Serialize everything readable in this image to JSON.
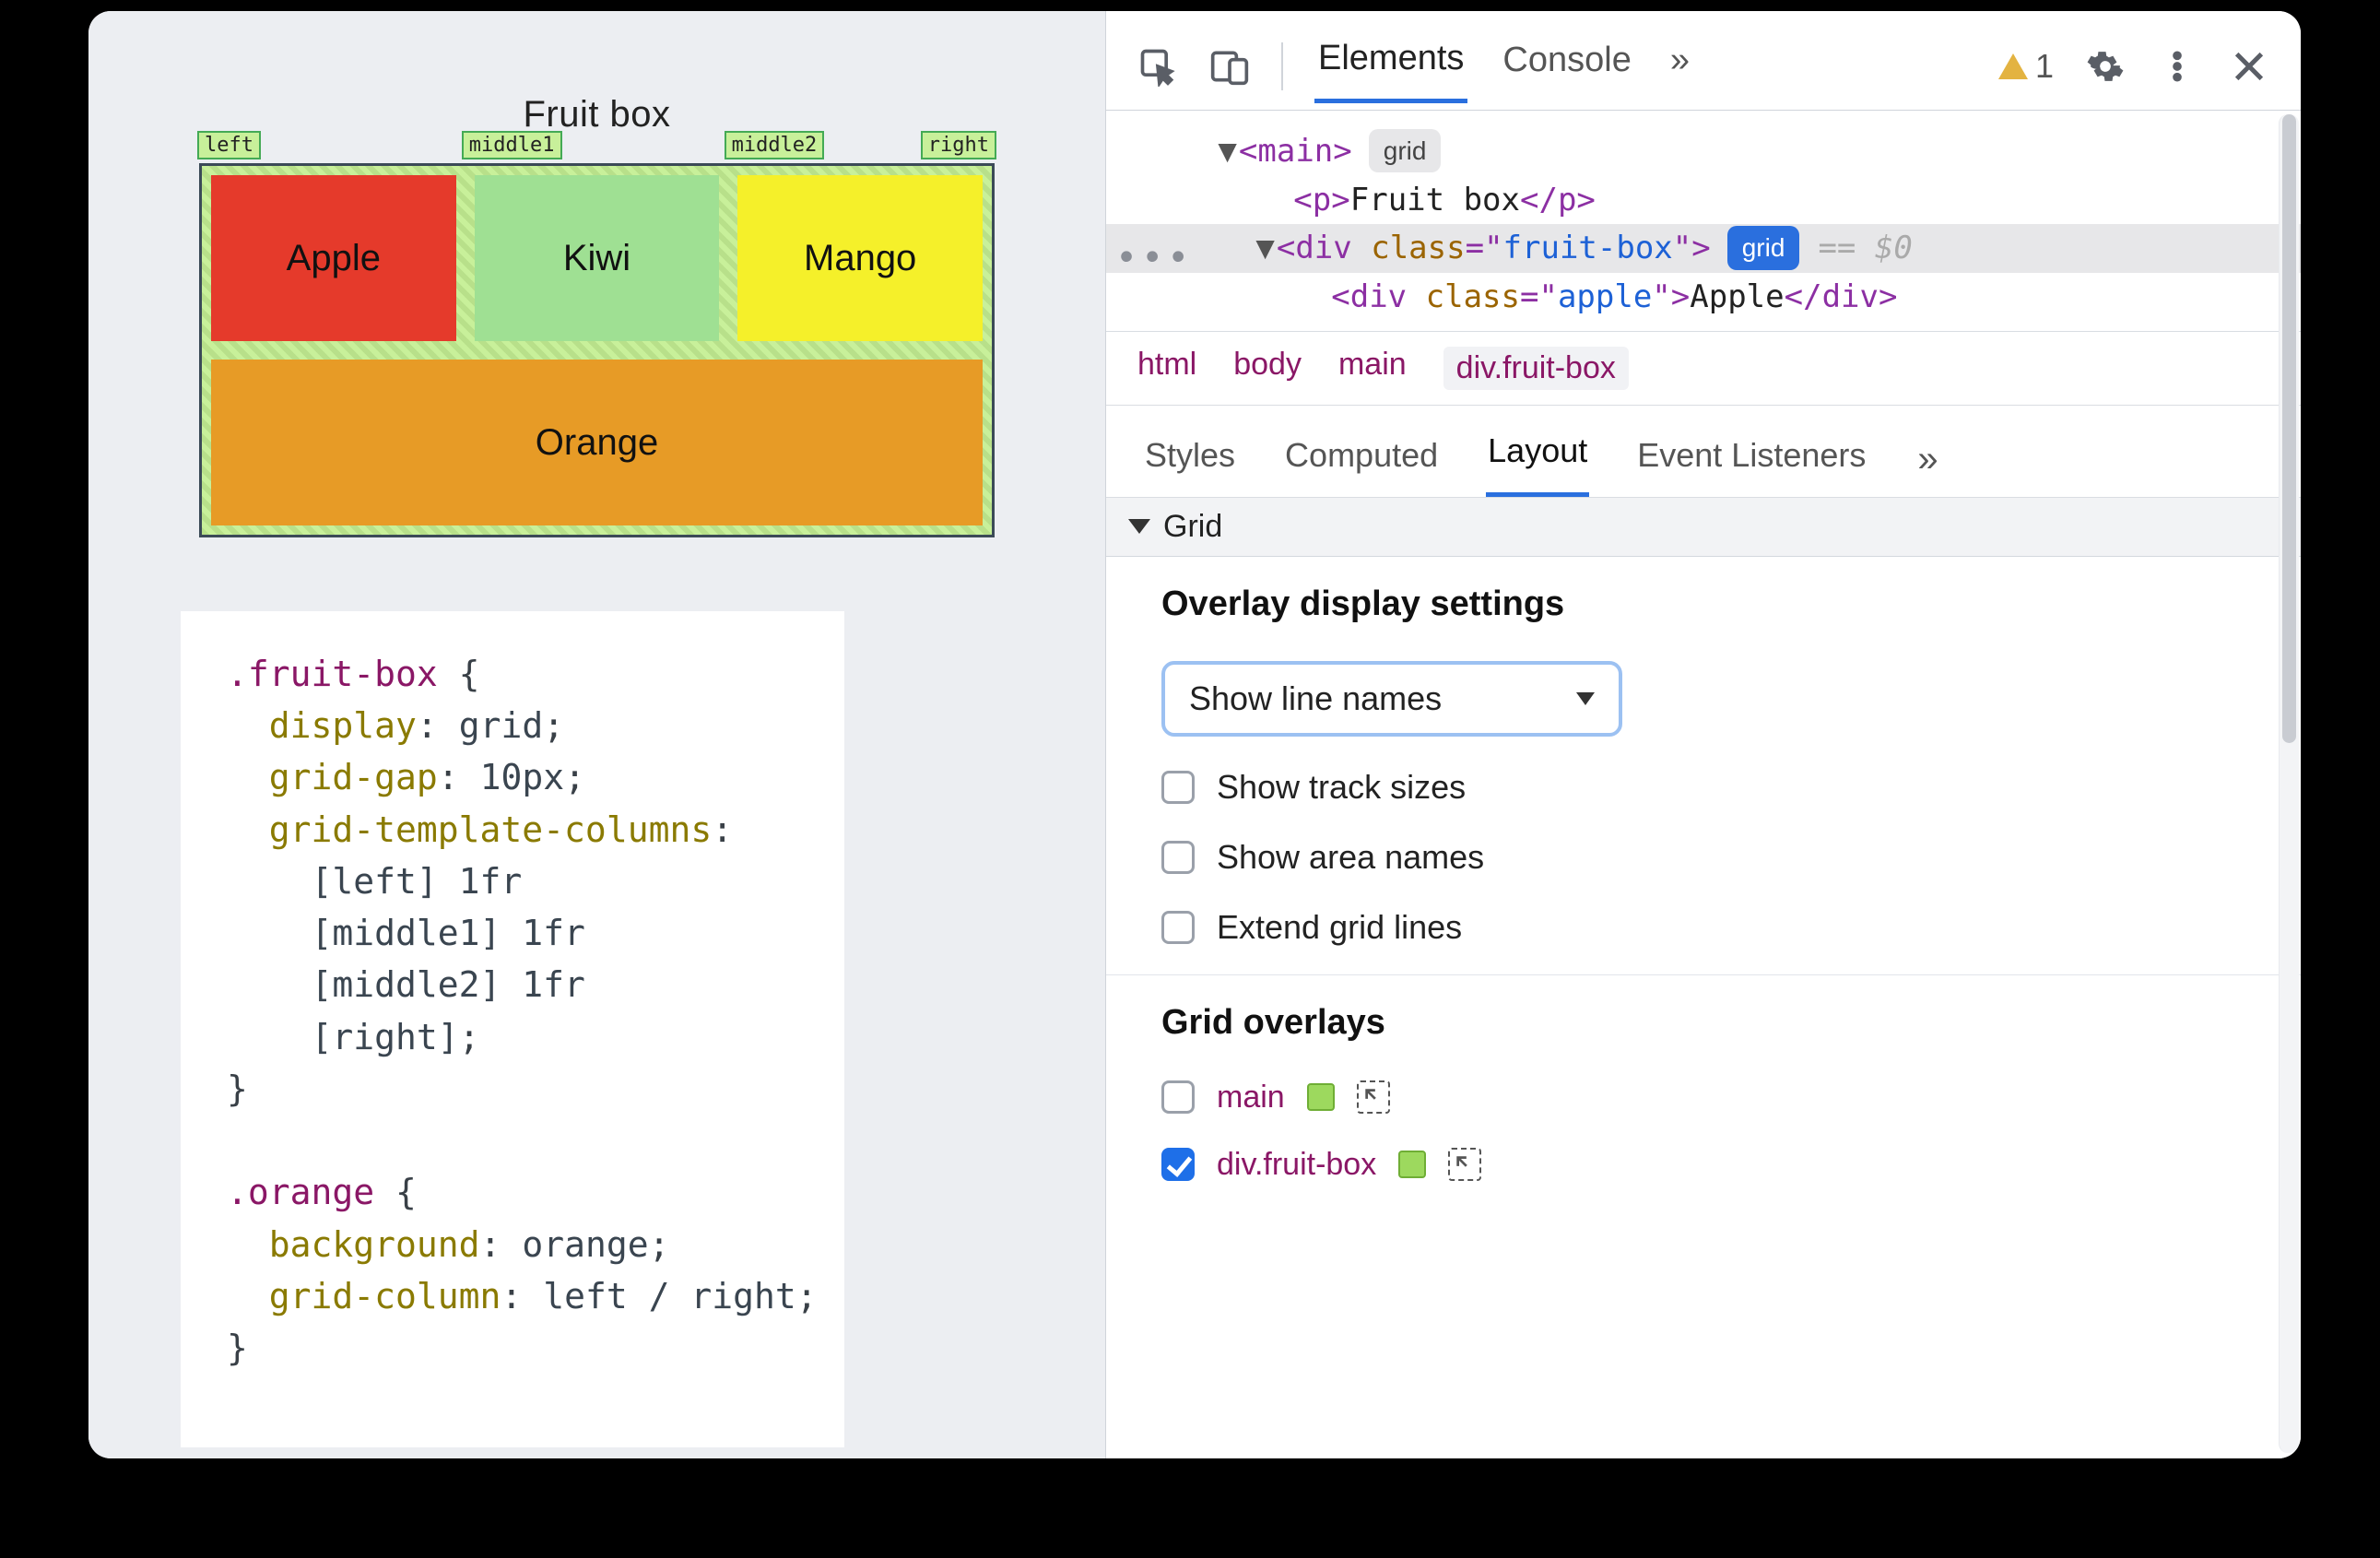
{
  "preview": {
    "title": "Fruit box",
    "line_names": [
      "left",
      "middle1",
      "middle2",
      "right"
    ],
    "cells": {
      "apple": "Apple",
      "kiwi": "Kiwi",
      "mango": "Mango",
      "orange": "Orange"
    }
  },
  "code": {
    "sel1": ".fruit-box",
    "p_display": "display",
    "v_display": "grid",
    "p_gap": "grid-gap",
    "v_gap": "10px",
    "p_gtc": "grid-template-columns",
    "gtc_lines": [
      "[left] 1fr",
      "[middle1] 1fr",
      "[middle2] 1fr",
      "[right]"
    ],
    "sel2": ".orange",
    "p_bg": "background",
    "v_bg": "orange",
    "p_gc": "grid-column",
    "v_gc": "left / right"
  },
  "devtools": {
    "tabs": {
      "elements": "Elements",
      "console": "Console",
      "more": "»"
    },
    "warning_count": "1",
    "dom": {
      "main_tag": "main",
      "main_badge": "grid",
      "p_tag": "p",
      "p_text": "Fruit box",
      "fb_tag": "div",
      "fb_class_attr": "class",
      "fb_class_val": "fruit-box",
      "fb_badge": "grid",
      "fb_after": "== $0",
      "apple_tag": "div",
      "apple_class_attr": "class",
      "apple_class_val": "apple",
      "apple_text": "Apple"
    },
    "crumbs": [
      "html",
      "body",
      "main",
      "div.fruit-box"
    ],
    "subtabs": {
      "styles": "Styles",
      "computed": "Computed",
      "layout": "Layout",
      "listeners": "Event Listeners",
      "more": "»"
    },
    "grid_section": "Grid",
    "overlay": {
      "heading": "Overlay display settings",
      "dropdown": "Show line names",
      "opts": {
        "track": "Show track sizes",
        "area": "Show area names",
        "extend": "Extend grid lines"
      }
    },
    "grid_overlays": {
      "heading": "Grid overlays",
      "items": [
        {
          "name": "main",
          "checked": false
        },
        {
          "name": "div.fruit-box",
          "checked": true
        }
      ]
    }
  }
}
